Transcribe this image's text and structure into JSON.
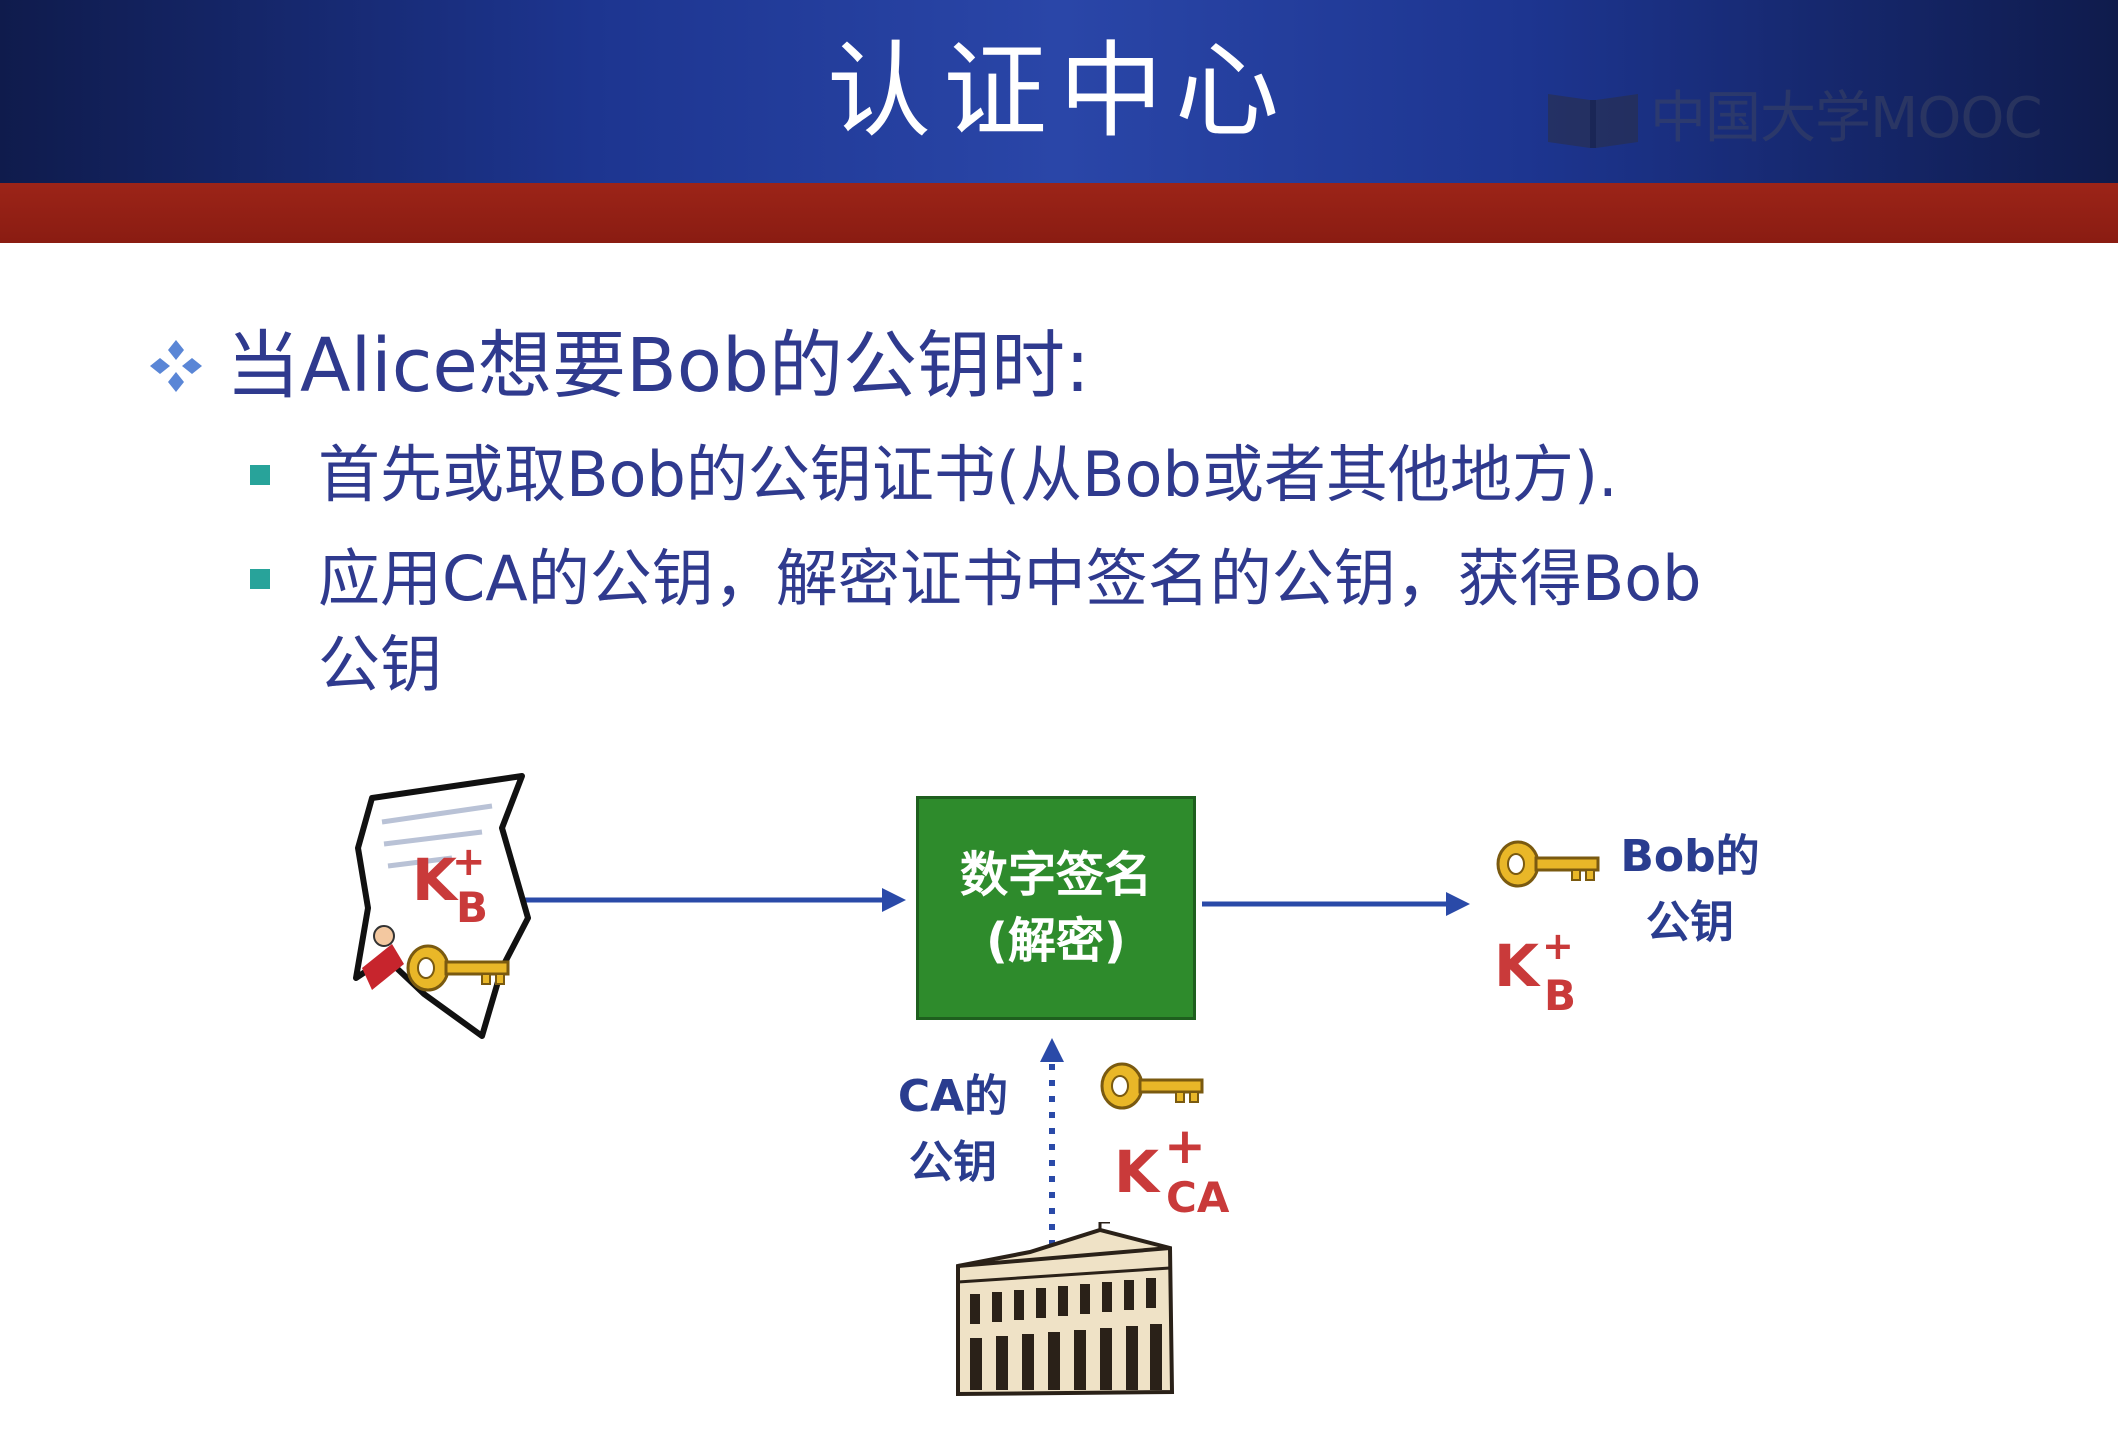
{
  "header": {
    "title": "认证中心",
    "logo_text": "中国大学MOOC"
  },
  "bullets": {
    "main": "当Alice想要Bob的公钥时:",
    "sub1": "首先或取Bob的公钥证书(从Bob或者其他地方).",
    "sub2_line1": "应用CA的公钥，解密证书中签名的公钥，获得Bob",
    "sub2_line2": "公钥"
  },
  "diagram": {
    "box_line1": "数字签名",
    "box_line2": "(解密)",
    "out_label_line1": "Bob的",
    "out_label_line2": "公钥",
    "ca_label_line1": "CA的",
    "ca_label_line2": "公钥",
    "cert_key": {
      "base": "K",
      "sup": "+",
      "sub": "B"
    },
    "out_key": {
      "base": "K",
      "sup": "+",
      "sub": "B"
    },
    "ca_key": {
      "base": "K",
      "sup": "+",
      "sub": "CA"
    }
  },
  "colors": {
    "header_blue": "#1d3590",
    "red_band": "#8a1c12",
    "text_blue": "#2f3a8e",
    "green_box": "#2e8b2c",
    "key_red": "#c93a3a",
    "bullet_teal": "#28a39a"
  },
  "icons": [
    "diamond-bullet-icon",
    "square-bullet-icon",
    "certificate-icon",
    "key-icon",
    "building-icon",
    "book-logo-icon"
  ]
}
